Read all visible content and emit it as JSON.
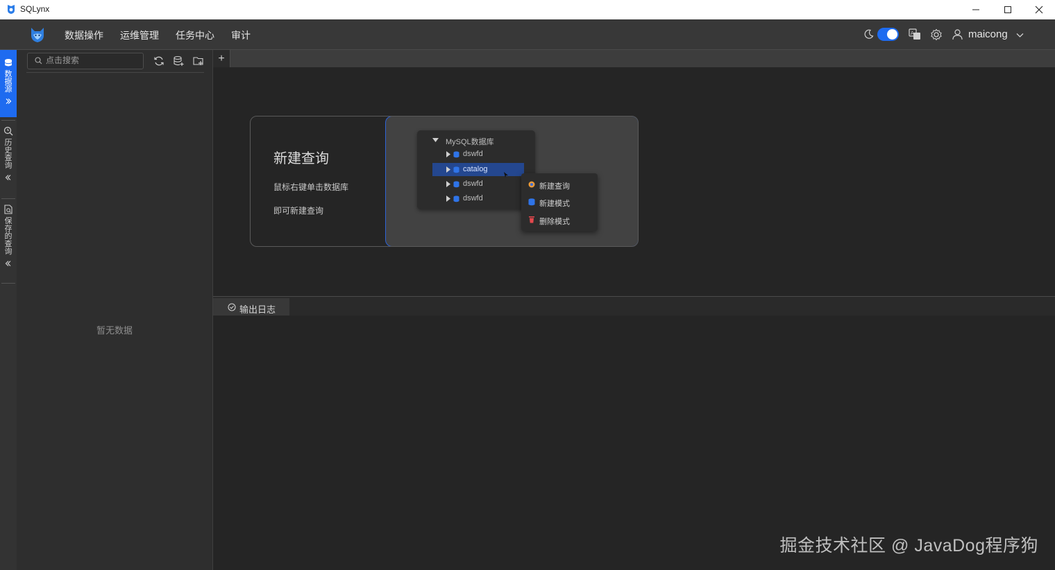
{
  "window": {
    "title": "SQLynx",
    "controls": [
      "minimize-icon",
      "maximize-icon",
      "close-icon"
    ]
  },
  "header": {
    "nav": [
      {
        "label": "数据操作"
      },
      {
        "label": "运维管理"
      },
      {
        "label": "任务中心"
      },
      {
        "label": "审计"
      }
    ],
    "theme_toggle_on": true,
    "username": "maicong"
  },
  "rail": {
    "tabs": [
      {
        "label": "数据源",
        "icon": "database-icon",
        "active": true
      },
      {
        "label": "历史查询",
        "icon": "search-history-icon",
        "active": false
      },
      {
        "label": "保存的查询",
        "icon": "saved-query-icon",
        "active": false
      }
    ]
  },
  "sidebar": {
    "search_placeholder": "点击搜索",
    "empty_text": "暂无数据"
  },
  "tabs": {
    "add_label": "+"
  },
  "guide": {
    "title": "新建查询",
    "line1": "鼠标右键单击数据库",
    "line2": "即可新建查询",
    "tree": [
      {
        "label": "MySQL数据库",
        "level": 0,
        "expanded": true
      },
      {
        "label": "dswfd",
        "level": 1
      },
      {
        "label": "catalog",
        "level": 1,
        "selected": true
      },
      {
        "label": "dswfd",
        "level": 1
      },
      {
        "label": "dswfd",
        "level": 1
      }
    ],
    "menu": [
      {
        "label": "新建查询",
        "icon": "new-query-icon"
      },
      {
        "label": "新建模式",
        "icon": "new-schema-icon"
      },
      {
        "label": "删除模式",
        "icon": "delete-icon"
      }
    ]
  },
  "output": {
    "tab_label": "输出日志"
  },
  "watermark": "掘金技术社区 @ JavaDog程序狗",
  "colors": {
    "accent": "#1e6bf0",
    "selected_row": "#24478f",
    "danger": "#e5484d"
  }
}
